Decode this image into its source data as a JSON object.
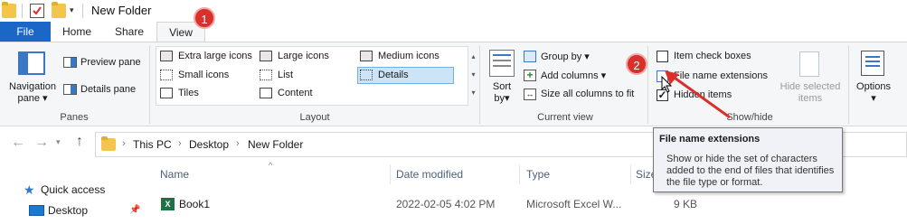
{
  "window": {
    "title": "New Folder"
  },
  "tabs": {
    "file": "File",
    "home": "Home",
    "share": "Share",
    "view": "View"
  },
  "ribbon": {
    "panes": {
      "navigation_pane_line1": "Navigation",
      "navigation_pane_line2": "pane",
      "preview_pane": "Preview pane",
      "details_pane": "Details pane",
      "group": "Panes"
    },
    "layout": {
      "items": [
        "Extra large icons",
        "Large icons",
        "Medium icons",
        "Small icons",
        "List",
        "Details",
        "Tiles",
        "Content"
      ],
      "group": "Layout"
    },
    "current_view": {
      "sort_line1": "Sort",
      "sort_line2": "by",
      "group_by": "Group by",
      "add_columns": "Add columns",
      "size_all_columns": "Size all columns to fit",
      "group": "Current view"
    },
    "show_hide": {
      "item_check_boxes": "Item check boxes",
      "file_name_extensions": "File name extensions",
      "hidden_items": "Hidden items",
      "hide_selected_line1": "Hide selected",
      "hide_selected_line2": "items",
      "group": "Show/hide"
    },
    "options": "Options"
  },
  "address": {
    "crumbs": [
      "This PC",
      "Desktop",
      "New Folder"
    ]
  },
  "columns": {
    "name": "Name",
    "date": "Date modified",
    "type": "Type",
    "size": "Size"
  },
  "sidebar": {
    "quick_access": "Quick access",
    "desktop": "Desktop"
  },
  "files": [
    {
      "name": "Book1",
      "date": "2022-02-05 4:02 PM",
      "type": "Microsoft Excel W...",
      "size": "9 KB"
    }
  ],
  "tooltip": {
    "title": "File name extensions",
    "body": "Show or hide the set of characters added to the end of files that identifies the file type or format."
  },
  "annotations": {
    "badge1": "1",
    "badge2": "2"
  },
  "colors": {
    "accent": "#1b67c7",
    "badge": "#d9302c"
  }
}
